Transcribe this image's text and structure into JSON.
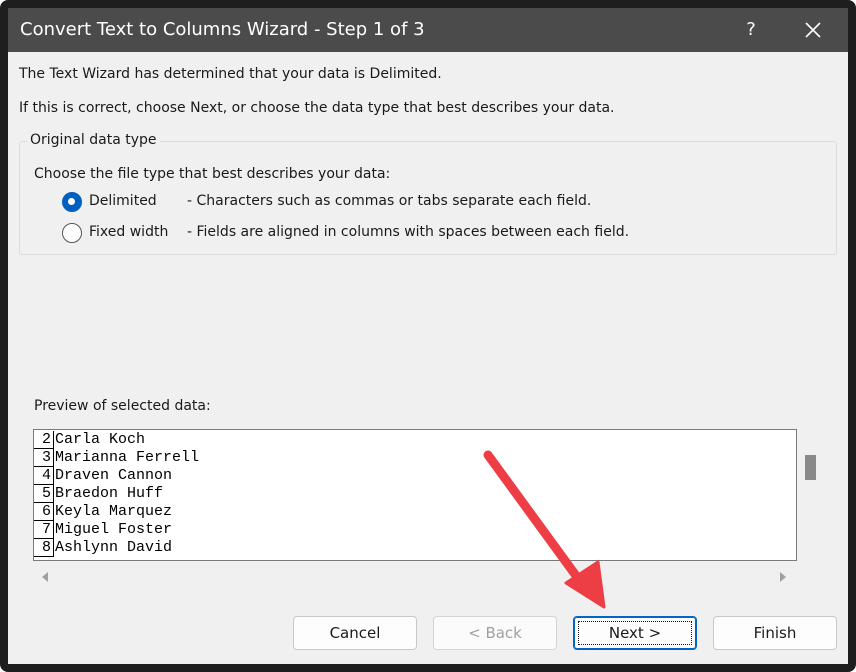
{
  "window": {
    "title": "Convert Text to Columns Wizard - Step 1 of 3",
    "help_glyph": "?"
  },
  "messages": {
    "line1": "The Text Wizard has determined that your data is Delimited.",
    "line2": "If this is correct, choose Next, or choose the data type that best describes your data."
  },
  "original_data_type": {
    "title": "Original data type",
    "prompt": "Choose the file type that best describes your data:",
    "options": [
      {
        "label": "Delimited",
        "description": "- Characters such as commas or tabs separate each field.",
        "selected": true
      },
      {
        "label": "Fixed width",
        "description": "- Fields are aligned in columns with spaces between each field.",
        "selected": false
      }
    ]
  },
  "preview": {
    "label": "Preview of selected data:",
    "rows": [
      {
        "num": "2",
        "text": "Carla Koch"
      },
      {
        "num": "3",
        "text": "Marianna Ferrell"
      },
      {
        "num": "4",
        "text": "Draven Cannon"
      },
      {
        "num": "5",
        "text": "Braedon Huff"
      },
      {
        "num": "6",
        "text": "Keyla Marquez"
      },
      {
        "num": "7",
        "text": "Miguel Foster"
      },
      {
        "num": "8",
        "text": "Ashlynn David"
      }
    ]
  },
  "buttons": {
    "cancel": "Cancel",
    "back": "< Back",
    "next": "Next >",
    "finish": "Finish"
  },
  "colors": {
    "titlebar": "#4b4b4b",
    "accent": "#0060c0",
    "annotation_arrow": "#ee3e45"
  }
}
